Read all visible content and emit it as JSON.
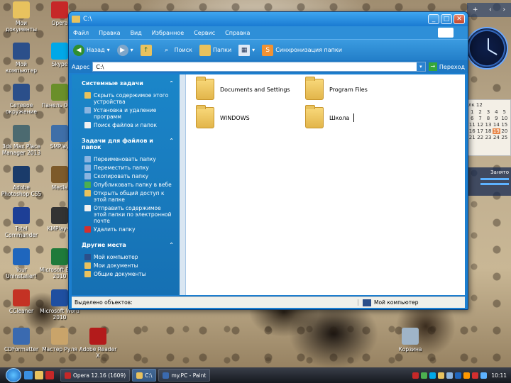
{
  "desktop": {
    "icons": [
      {
        "label": "Мои документы",
        "color": "#e8c25e"
      },
      {
        "label": "Opera",
        "color": "#c62828"
      },
      {
        "label": "Мой компьютер",
        "color": "#2b4f8a"
      },
      {
        "label": "Skype",
        "color": "#00a8e8"
      },
      {
        "label": "Сетевое окружение",
        "color": "#2b4f8a"
      },
      {
        "label": "Панель 0001",
        "color": "#6a8f2a"
      },
      {
        "label": "3ds Max Place Manager 2013",
        "color": "#4c6a70"
      },
      {
        "label": "SMPlay",
        "color": "#3f6fa8"
      },
      {
        "label": "Adobe Photoshop CS5",
        "color": "#1a3b6a"
      },
      {
        "label": "Media",
        "color": "#7d5a2a"
      },
      {
        "label": "Total Commander",
        "color": "#1d3f96"
      },
      {
        "label": "KMPlayer",
        "color": "#333"
      },
      {
        "label": "Your Uninstaller!",
        "color": "#1f66bd"
      },
      {
        "label": "Microsoft Excel 2010",
        "color": "#1f7a3a"
      },
      {
        "label": "CCleaner",
        "color": "#c43224"
      },
      {
        "label": "Microsoft Word 2010",
        "color": "#1f4fa0"
      },
      {
        "label": "CDFormatter",
        "color": "#3a6ab0"
      },
      {
        "label": "Мастер Руля",
        "color": "#c9a46a"
      },
      {
        "label": "Adobe Reader X",
        "color": "#b31b1b"
      },
      {
        "label": "Корзина",
        "color": "#9fb4c8"
      }
    ]
  },
  "window": {
    "title": "C:\\",
    "menu": [
      "Файл",
      "Правка",
      "Вид",
      "Избранное",
      "Сервис",
      "Справка"
    ],
    "toolbar": {
      "back": "Назад",
      "search": "Поиск",
      "folders": "Папки",
      "sync": "Синхронизация папки"
    },
    "address": {
      "label": "Адрес",
      "value": "C:\\",
      "go": "Переход"
    },
    "left_pane": {
      "system_tasks": {
        "title": "Системные задачи",
        "items": [
          {
            "label": "Скрыть содержимое этого устройства",
            "color": "#e8c25e"
          },
          {
            "label": "Установка и удаление программ",
            "color": "#8ab4e0"
          },
          {
            "label": "Поиск файлов и папок",
            "color": "#f0f0f0"
          }
        ]
      },
      "file_tasks": {
        "title": "Задачи для файлов и папок",
        "items": [
          {
            "label": "Переименовать папку",
            "color": "#8ab4e0"
          },
          {
            "label": "Переместить папку",
            "color": "#8ab4e0"
          },
          {
            "label": "Скопировать папку",
            "color": "#8ab4e0"
          },
          {
            "label": "Опубликовать папку в вебе",
            "color": "#4caf50"
          },
          {
            "label": "Открыть общий доступ к этой папке",
            "color": "#e8c25e"
          },
          {
            "label": "Отправить содержимое этой папки по электронной почте",
            "color": "#f0f0f0"
          },
          {
            "label": "Удалить папку",
            "color": "#d32f2f"
          }
        ]
      },
      "other_places": {
        "title": "Другие места",
        "items": [
          {
            "label": "Мой компьютер",
            "color": "#2b4f8a"
          },
          {
            "label": "Мои документы",
            "color": "#e8c25e"
          },
          {
            "label": "Общие документы",
            "color": "#e8c25e"
          }
        ]
      },
      "collapse_glyph": "⌃"
    },
    "folders": [
      {
        "name": "Documents and Settings"
      },
      {
        "name": "Program Files"
      },
      {
        "name": "WINDOWS"
      },
      {
        "name": "Школа"
      }
    ],
    "status": {
      "selected": "Выделено объектов:",
      "location": "Мой компьютер"
    },
    "buttons": {
      "minimize": "_",
      "maximize": "□",
      "close": "✕"
    }
  },
  "gadgets": {
    "top_controls": [
      "+",
      "‹",
      "›"
    ],
    "calendar": {
      "head": "лк 12",
      "days": [
        "1",
        "2",
        "3",
        "4",
        "5",
        "6",
        "7",
        "8",
        "9",
        "10",
        "11",
        "12",
        "13",
        "14",
        "15",
        "16",
        "17",
        "18",
        "19",
        "20",
        "21",
        "22",
        "23",
        "24",
        "25"
      ],
      "today": "19"
    },
    "cpu_label": "Занято"
  },
  "taskbar": {
    "buttons": [
      {
        "label": "Opera 12.16 (1609)",
        "color": "#c62828",
        "active": false
      },
      {
        "label": "C:\\",
        "color": "#e8c25e",
        "active": true
      },
      {
        "label": "my.PC - Paint",
        "color": "#3a6ab0",
        "active": false
      }
    ],
    "quicklaunch_colors": [
      "#3a8fe0",
      "#e8c25e",
      "#c62828"
    ],
    "tray_colors": [
      "#c62828",
      "#4caf50",
      "#00a8e8",
      "#e8c25e",
      "#8ab4e0",
      "#1f66bd",
      "#ff9800",
      "#d32f2f",
      "#5db2ff"
    ],
    "time": "10:11"
  }
}
